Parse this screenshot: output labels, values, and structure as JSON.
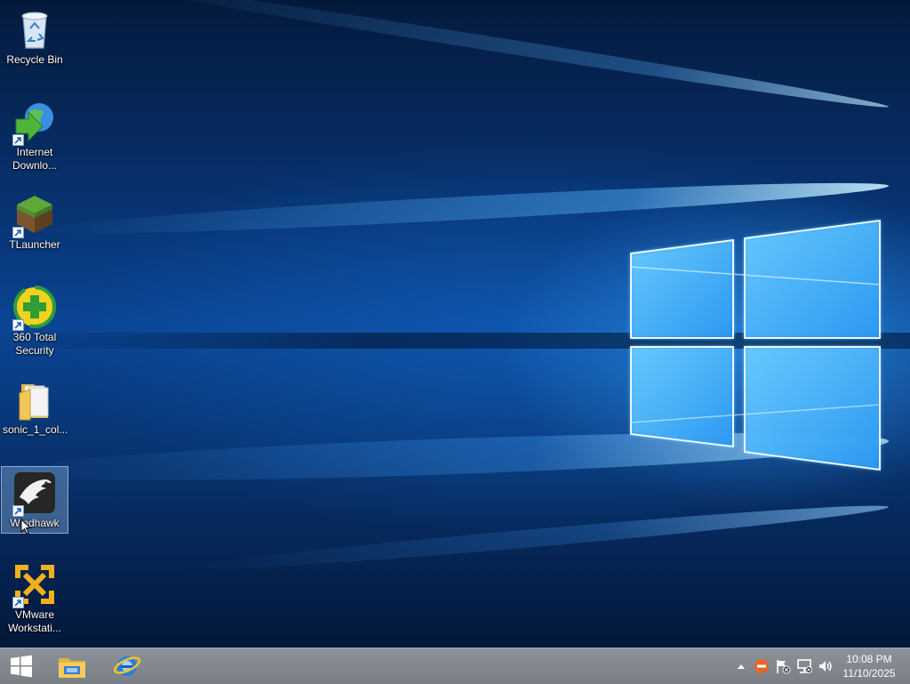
{
  "desktop": {
    "icons": [
      {
        "label": "Recycle Bin",
        "icon": "recycle-bin-icon",
        "shortcut": false,
        "selected": false
      },
      {
        "label": "Internet Downlo...",
        "icon": "internet-download-manager-icon",
        "shortcut": true,
        "selected": false
      },
      {
        "label": "TLauncher",
        "icon": "tlauncher-icon",
        "shortcut": true,
        "selected": false
      },
      {
        "label": "360 Total Security",
        "icon": "360-total-security-icon",
        "shortcut": true,
        "selected": false
      },
      {
        "label": "sonic_1_col...",
        "icon": "folder-icon",
        "shortcut": false,
        "selected": false
      },
      {
        "label": "Windhawk",
        "icon": "windhawk-icon",
        "shortcut": true,
        "selected": true
      },
      {
        "label": "VMware Workstati...",
        "icon": "vmware-workstation-icon",
        "shortcut": true,
        "selected": false
      }
    ]
  },
  "taskbar": {
    "start_icon": "windows-logo-icon",
    "pinned": [
      {
        "name": "File Explorer",
        "icon": "file-explorer-icon"
      },
      {
        "name": "Internet Explorer",
        "icon": "internet-explorer-icon"
      }
    ],
    "tray": {
      "icons": [
        "show-hidden-icons-chevron-icon",
        "360-tray-icon",
        "action-center-flag-icon",
        "network-icon",
        "volume-icon"
      ]
    },
    "clock": {
      "time": "10:08 PM",
      "date": "11/10/2025"
    }
  },
  "colors": {
    "wallpaper_dark": "#031a3a",
    "wallpaper_light": "#3aa8ff",
    "taskbar": "#858a91",
    "selection": "#96bee6"
  }
}
